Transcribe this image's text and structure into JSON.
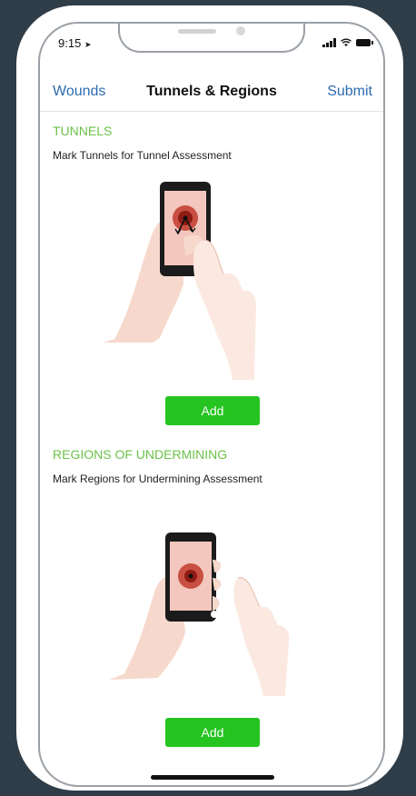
{
  "status_bar": {
    "time": "9:15",
    "location_icon": "location-arrow-icon",
    "icons": [
      "signal-icon",
      "wifi-icon",
      "battery-icon"
    ]
  },
  "nav": {
    "back_label": "Wounds",
    "title": "Tunnels & Regions",
    "submit_label": "Submit"
  },
  "sections": [
    {
      "title": "TUNNELS",
      "description": "Mark Tunnels for Tunnel Assessment",
      "illustration_icon": "hand-marking-tunnels-illustration",
      "button_label": "Add"
    },
    {
      "title": "REGIONS OF UNDERMINING",
      "description": "Mark Regions for Undermining Assessment",
      "illustration_icon": "hand-marking-regions-illustration",
      "button_label": "Add"
    }
  ],
  "colors": {
    "background": "#2f3d48",
    "accent_link": "#2b6cb0",
    "section_title": "#6cc24a",
    "button": "#26c421",
    "skin": "#f6d9cc",
    "wound": "#c0392b"
  }
}
